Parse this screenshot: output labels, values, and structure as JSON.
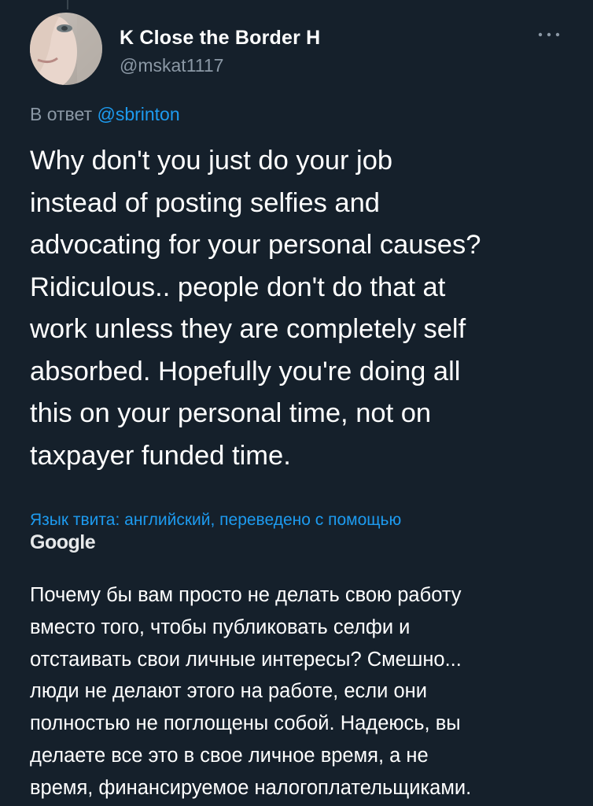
{
  "tweet": {
    "author": {
      "display_name": "K Close the Border H",
      "handle": "@mskat1117",
      "avatar_icon": "profile-photo"
    },
    "reply_prefix": "В ответ ",
    "reply_to": "@sbrinton",
    "more_icon": "ellipsis-icon",
    "text_lines": [
      "Why don't you just do your job",
      "instead of posting selfies and",
      "advocating for your personal causes?",
      "Ridiculous.. people don't do that at",
      "work unless they are completely self",
      "absorbed. Hopefully you're doing all",
      "this on your personal time, not on",
      "taxpayer funded time."
    ],
    "translation": {
      "meta": "Язык твита: английский, переведено с помощью",
      "provider": "Google",
      "text_lines": [
        "Почему бы вам просто не делать свою работу",
        "вместо того, чтобы публиковать селфи и",
        "отстаивать свои личные интересы? Смешно...",
        "люди не делают этого на работе, если они",
        "полностью не поглощены собой. Надеюсь, вы",
        "делаете все это в свое личное время, а не",
        "время, финансируемое налогоплательщиками."
      ]
    }
  },
  "colors": {
    "background": "#15202b",
    "text_primary": "#ffffff",
    "text_secondary": "#8b98a5",
    "accent": "#1d9bf0"
  }
}
